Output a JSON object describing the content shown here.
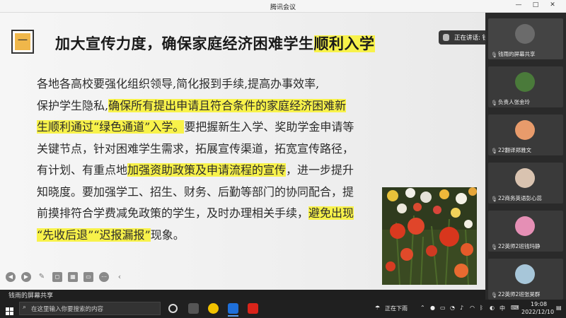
{
  "window": {
    "title": "腾讯会议"
  },
  "slide": {
    "number": "一",
    "heading_plain": "加大宣传力度，确保家庭经济困难学生",
    "heading_highlight": "顺利入学",
    "lines": [
      [
        {
          "t": "各地各高校要强化组织领导,简化报到手续,提高办事效率,",
          "h": false
        }
      ],
      [
        {
          "t": "保护学生隐私,",
          "h": false
        },
        {
          "t": "确保所有提出申请且符合条件的家庭经济困难新",
          "h": true
        }
      ],
      [
        {
          "t": "生顺利通过“绿色通道”入学。",
          "h": true
        },
        {
          "t": "要把握新生入学、奖助学金申请等",
          "h": false
        }
      ],
      [
        {
          "t": "关键节点，针对困难学生需求，拓展宣传渠道，拓宽宣传路径，",
          "h": false
        }
      ],
      [
        {
          "t": "有计划、有重点地",
          "h": false
        },
        {
          "t": "加强资助政策及申请流程的宣传",
          "h": true
        },
        {
          "t": "，进一步提升",
          "h": false
        }
      ],
      [
        {
          "t": "知晓度。要加强学工、招生、财务、后勤等部门的协同配合，提",
          "h": false
        }
      ],
      [
        {
          "t": "前摸排符合学费减免政策的学生，及时办理相关手续，",
          "h": false
        },
        {
          "t": "避免出现",
          "h": true
        }
      ],
      [
        {
          "t": "“先收后退”“迟报漏报”",
          "h": true
        },
        {
          "t": "现象。",
          "h": false
        }
      ]
    ]
  },
  "share_bar": {
    "label": "钱雨的屏幕共享"
  },
  "speaking": {
    "label": "正在讲话: 钱雨;"
  },
  "participants": [
    {
      "name": "钱雨的屏幕共享",
      "color": "#6b6b6b"
    },
    {
      "name": "负责人张金玲",
      "color": "#4a7a3a"
    },
    {
      "name": "22翻译郑雅文",
      "color": "#e89b6b"
    },
    {
      "name": "22商务英语彭心蕊",
      "color": "#d9c3b0"
    },
    {
      "name": "22英师2班钱玛静",
      "color": "#e58fb5"
    },
    {
      "name": "22英师2班张昊群",
      "color": "#a7c6d9"
    }
  ],
  "taskbar": {
    "search_placeholder": "在这里输入你要搜索的内容",
    "weather": "正在下雨",
    "lang": "中",
    "time": "19:08",
    "date": "2022/12/10"
  }
}
